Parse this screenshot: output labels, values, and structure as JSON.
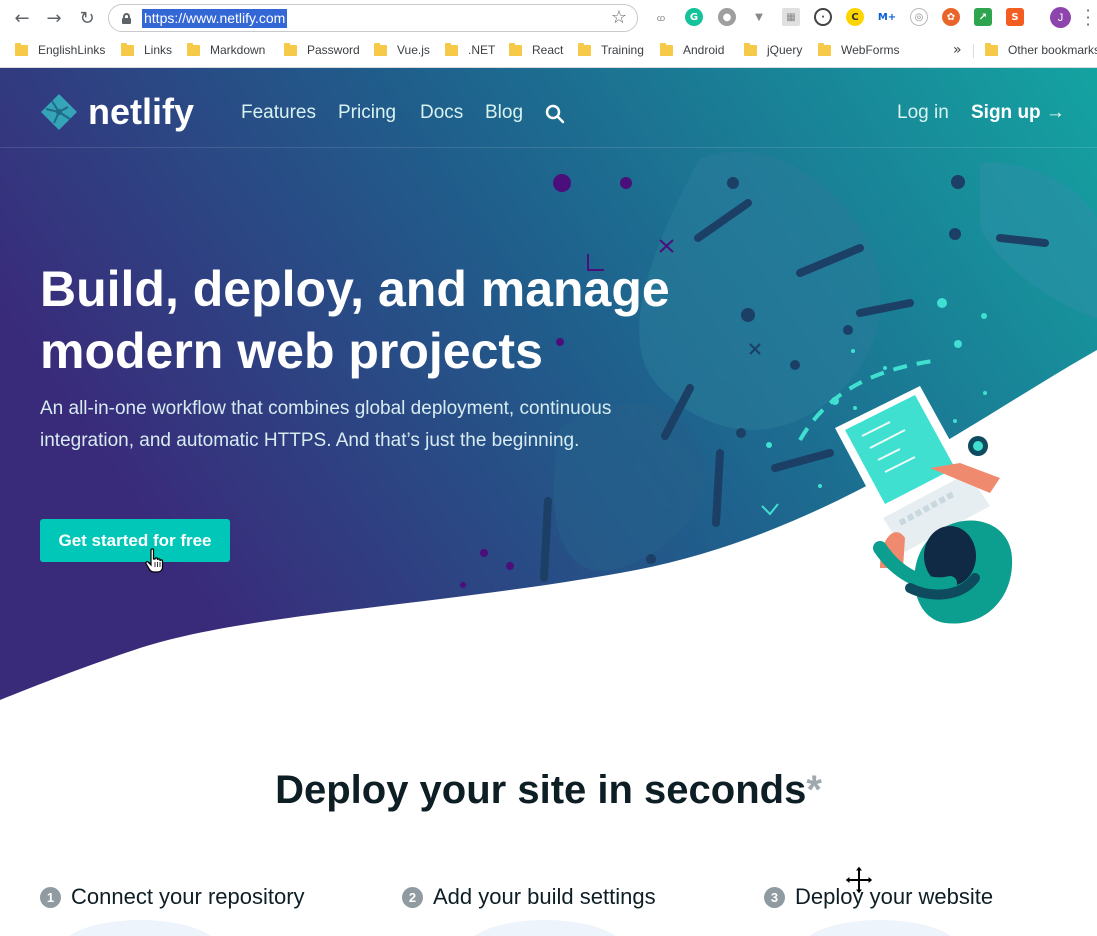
{
  "browser": {
    "url": "https://www.netlify.com",
    "profile_initial": "J",
    "bookmarks": [
      "EnglishLinks",
      "Links",
      "Markdown",
      "Password",
      "Vue.js",
      ".NET",
      "React",
      "Training",
      "Android",
      "jQuery",
      "WebForms"
    ],
    "more_bookmarks": "»",
    "other_bookmarks": "Other bookmarks"
  },
  "site": {
    "logo_text": "netlify",
    "nav": [
      "Features",
      "Pricing",
      "Docs",
      "Blog"
    ],
    "login": "Log in",
    "signup": "Sign up →"
  },
  "hero": {
    "headline_line1": "Build, deploy, and manage",
    "headline_line2": "modern web projects",
    "subtext": "An all-in-one workflow that combines global deployment, continuous integration, and automatic HTTPS. And that’s just the beginning.",
    "cta": "Get started for free"
  },
  "deploy": {
    "title": "Deploy your site in seconds",
    "asterisk": "*",
    "steps": [
      {
        "num": "1",
        "label": "Connect your repository"
      },
      {
        "num": "2",
        "label": "Add your build settings"
      },
      {
        "num": "3",
        "label": "Deploy your website"
      }
    ]
  },
  "colors": {
    "brand_teal": "#00c7b7",
    "hero_dark": "#3a2a7a",
    "hero_light": "#14a3a1"
  }
}
